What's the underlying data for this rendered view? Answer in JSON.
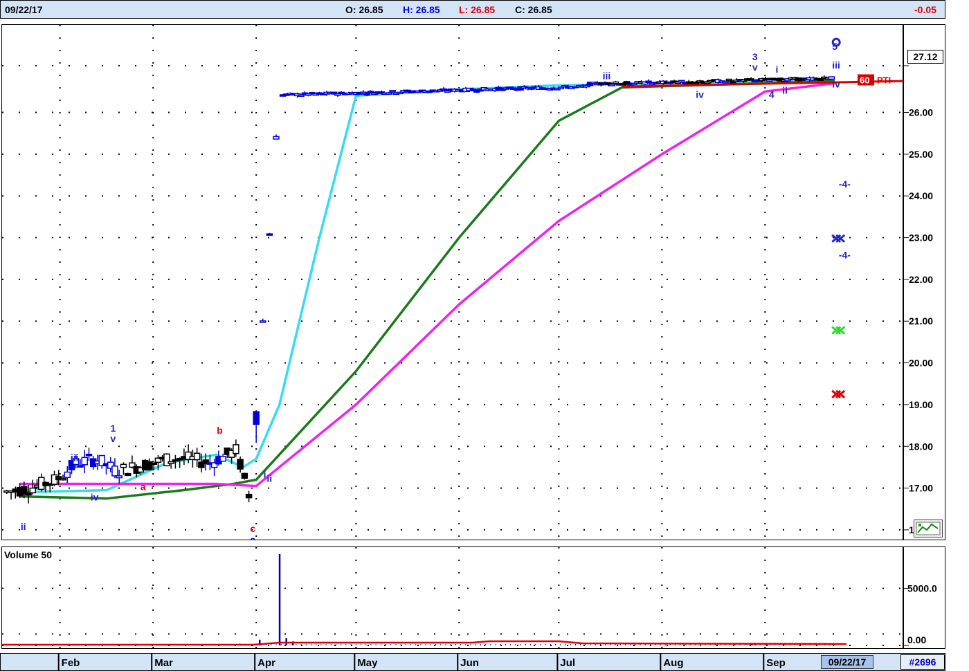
{
  "header": {
    "date": "09/22/17",
    "open": "O: 26.85",
    "high": "H: 26.85",
    "low": "L: 26.85",
    "close": "C: 26.85",
    "change": "-0.05"
  },
  "price_tag": "27.12",
  "volume_panel_label": "Volume 50",
  "footer": {
    "cursor_date": "09/22/17",
    "symbol_count": "#2696"
  },
  "colors": {
    "up": "#0000dd",
    "down": "#000000",
    "cyan_line": "#33ddee",
    "green_line": "#1a7a1a",
    "magenta_line": "#ee22ee",
    "wave_label": "#2222cc",
    "abc_label": "#dd0000",
    "grid_dot": "#000000",
    "header_bg": "#d4e4f7"
  },
  "icons": [
    "chart-tools-icon"
  ],
  "chart_data": [
    {
      "type": "line",
      "title": "",
      "ylim": [
        15.8,
        27.6
      ],
      "y_ticks": [
        "16.00",
        "17.00",
        "18.00",
        "19.00",
        "20.00",
        "21.00",
        "22.00",
        "23.00",
        "24.00",
        "25.00",
        "26.00",
        "27.12"
      ],
      "x_months": [
        "Feb",
        "Mar",
        "Apr",
        "May",
        "Jun",
        "Jul",
        "Aug",
        "Sep"
      ],
      "grid": true,
      "series": [
        {
          "name": "",
          "color": "cyan",
          "x": [
            "01/20/17",
            "02/15/17",
            "03/05/17",
            "03/20/17",
            "03/28/17",
            "04/01/17",
            "04/08/17",
            "04/20/17",
            "05/01/17",
            "06/01/17",
            "07/01/17",
            "08/01/17",
            "09/22/17"
          ],
          "values": [
            16.9,
            16.95,
            17.6,
            17.8,
            17.5,
            17.7,
            19.0,
            23.0,
            26.4,
            26.55,
            26.65,
            26.7,
            26.8
          ]
        },
        {
          "name": "",
          "color": "green",
          "x": [
            "01/20/17",
            "02/15/17",
            "03/10/17",
            "03/25/17",
            "04/01/17",
            "05/01/17",
            "06/01/17",
            "07/01/17",
            "07/20/17",
            "09/22/17"
          ],
          "values": [
            16.8,
            16.75,
            16.95,
            17.1,
            17.2,
            19.8,
            23.0,
            25.8,
            26.6,
            26.75
          ]
        },
        {
          "name": "",
          "color": "magenta",
          "x": [
            "01/20/17",
            "03/20/17",
            "04/01/17",
            "05/01/17",
            "06/01/17",
            "07/01/17",
            "08/01/17",
            "09/01/17",
            "09/22/17"
          ],
          "values": [
            17.1,
            17.1,
            17.05,
            19.0,
            21.4,
            23.4,
            25.0,
            26.5,
            26.7
          ]
        }
      ],
      "wave_labels": [
        {
          "text": "ii",
          "x": "01/21/17",
          "y": 16.0,
          "color": "blue"
        },
        {
          "text": "iii",
          "x": "02/05/17",
          "y": 17.65,
          "color": "blue"
        },
        {
          "text": "iv",
          "x": "02/11/17",
          "y": 16.7,
          "color": "blue"
        },
        {
          "text": "1",
          "x": "02/17/17",
          "y": 18.35,
          "color": "blue"
        },
        {
          "text": "v",
          "x": "02/17/17",
          "y": 18.1,
          "color": "blue"
        },
        {
          "text": "a",
          "x": "02/26/17",
          "y": 16.95,
          "color": "red"
        },
        {
          "text": "b",
          "x": "03/21/17",
          "y": 18.3,
          "color": "red"
        },
        {
          "text": "c",
          "x": "03/31/17",
          "y": 15.95,
          "color": "red"
        },
        {
          "text": "2",
          "x": "03/31/17",
          "y": 15.65,
          "color": "blue"
        },
        {
          "text": "i",
          "x": "04/04/17",
          "y": 17.25,
          "color": "blue"
        },
        {
          "text": "ii",
          "x": "04/05/17",
          "y": 17.15,
          "color": "blue"
        },
        {
          "text": "iii",
          "x": "07/15/17",
          "y": 26.8,
          "color": "blue"
        },
        {
          "text": "iv",
          "x": "08/12/17",
          "y": 26.35,
          "color": "blue"
        },
        {
          "text": "3",
          "x": "08/29/17",
          "y": 27.25,
          "color": "blue"
        },
        {
          "text": "v",
          "x": "08/29/17",
          "y": 27.0,
          "color": "blue"
        },
        {
          "text": "4",
          "x": "09/03/17",
          "y": 26.35,
          "color": "blue"
        },
        {
          "text": "i",
          "x": "09/05/17",
          "y": 26.95,
          "color": "blue"
        },
        {
          "text": "ii",
          "x": "09/07/17",
          "y": 26.45,
          "color": "blue"
        },
        {
          "text": "iii",
          "x": "09/22/17",
          "y": 27.05,
          "color": "blue"
        },
        {
          "text": "iv",
          "x": "09/22/17",
          "y": 26.6,
          "color": "blue"
        },
        {
          "text": "5",
          "x": "09/22/17",
          "y": 27.5,
          "color": "blue"
        },
        {
          "text": "-4-",
          "x": "09/24/17",
          "y": 24.2,
          "color": "blue"
        },
        {
          "text": "-4-",
          "x": "09/24/17",
          "y": 22.5,
          "color": "blue"
        }
      ],
      "pti_label": {
        "value": "60",
        "text": "PTI"
      },
      "markers": [
        {
          "type": "x",
          "x": "09/22/17",
          "y": 22.98,
          "color": "blue"
        },
        {
          "type": "x",
          "x": "09/22/17",
          "y": 20.78,
          "color": "green"
        },
        {
          "type": "x",
          "x": "09/22/17",
          "y": 19.25,
          "color": "red"
        }
      ]
    },
    {
      "type": "bar",
      "title": "Volume 50",
      "y_ticks": [
        "0.00",
        "5000.0"
      ],
      "ylim": [
        0,
        8000
      ],
      "x": [
        "03/27/17",
        "04/02/17",
        "04/08/17",
        "04/10/17",
        "04/12/17",
        "08/28/17",
        "08/29/17"
      ],
      "values": [
        150,
        500,
        8000,
        650,
        350,
        180,
        220
      ],
      "moving_average": {
        "name": "",
        "color": "red",
        "level": 80
      }
    }
  ]
}
